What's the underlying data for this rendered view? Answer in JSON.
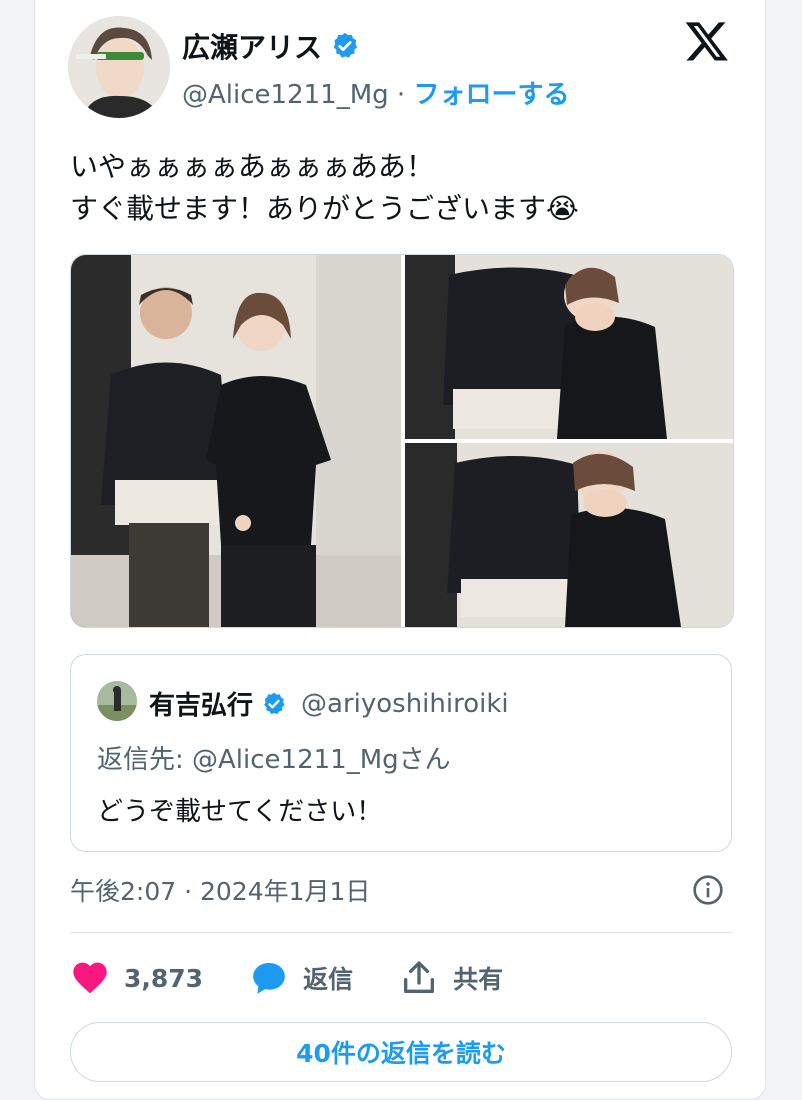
{
  "author": {
    "display_name": "広瀬アリス",
    "handle": "@Alice1211_Mg",
    "separator": " · ",
    "follow_label": "フォローする",
    "verified_color": "#1d9bf0"
  },
  "brand_icon": "x-logo-icon",
  "tweet": {
    "text": "いやぁぁぁぁあぁぁぁああ！\nすぐ載せます！ありがとうございます😭"
  },
  "media": {
    "count": 3,
    "items": [
      "photo-left",
      "photo-top-right",
      "photo-bottom-right"
    ]
  },
  "quoted": {
    "display_name": "有吉弘行",
    "handle": "@ariyoshihiroiki",
    "reply_to": "返信先: @Alice1211_Mgさん",
    "text": "どうぞ載せてください！"
  },
  "timestamp": "午後2:07 · 2024年1月1日",
  "actions": {
    "like_count": "3,873",
    "reply_label": "返信",
    "share_label": "共有",
    "like_color": "#f91880",
    "accent": "#1d9bf0"
  },
  "read_replies_label": "40件の返信を読む"
}
